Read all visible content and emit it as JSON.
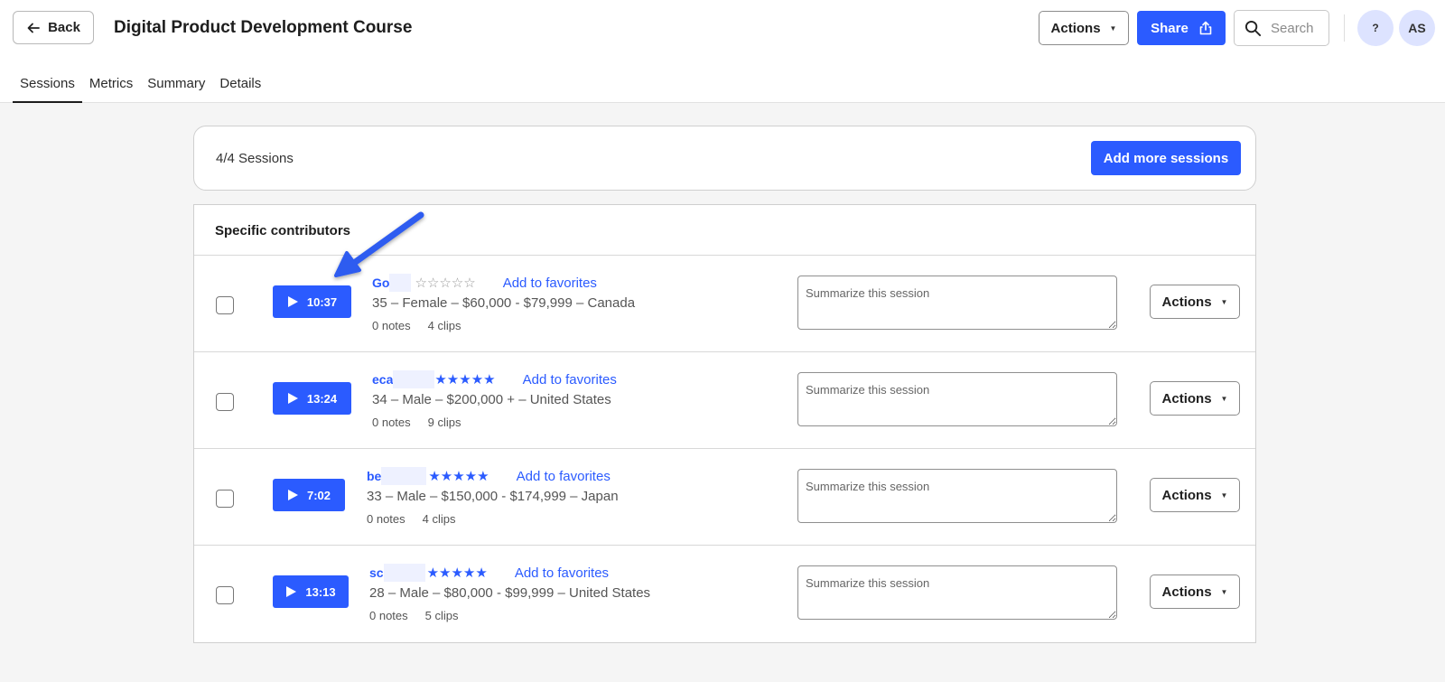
{
  "header": {
    "back_label": "Back",
    "title": "Digital Product Development Course",
    "actions_label": "Actions",
    "share_label": "Share",
    "search_placeholder": "Search",
    "help_label": "?",
    "avatar_initials": "AS"
  },
  "tabs": [
    {
      "label": "Sessions",
      "active": true
    },
    {
      "label": "Metrics",
      "active": false
    },
    {
      "label": "Summary",
      "active": false
    },
    {
      "label": "Details",
      "active": false
    }
  ],
  "sessions_bar": {
    "count_label": "4/4 Sessions",
    "add_button_label": "Add more sessions"
  },
  "list": {
    "heading": "Specific contributors",
    "actions_label": "Actions",
    "favorite_label": "Add to favorites",
    "summary_placeholder": "Summarize this session",
    "rows": [
      {
        "duration": "10:37",
        "name_prefix": "Go",
        "rating": 0,
        "demographics": "35 – Female – $60,000 - $79,999 – Canada",
        "notes": "0 notes",
        "clips": "4 clips"
      },
      {
        "duration": "13:24",
        "name_prefix": "eca",
        "rating": 5,
        "demographics": "34 – Male – $200,000 + – United States",
        "notes": "0 notes",
        "clips": "9 clips"
      },
      {
        "duration": "7:02",
        "name_prefix": "be",
        "rating": 5,
        "demographics": "33 – Male – $150,000 - $174,999 – Japan",
        "notes": "0 notes",
        "clips": "4 clips"
      },
      {
        "duration": "13:13",
        "name_prefix": "sc",
        "rating": 5,
        "demographics": "28 – Male – $80,000 - $99,999 – United States",
        "notes": "0 notes",
        "clips": "5 clips"
      }
    ]
  },
  "colors": {
    "accent": "#2b5bff",
    "annotation_arrow": "#2f5bf0"
  }
}
